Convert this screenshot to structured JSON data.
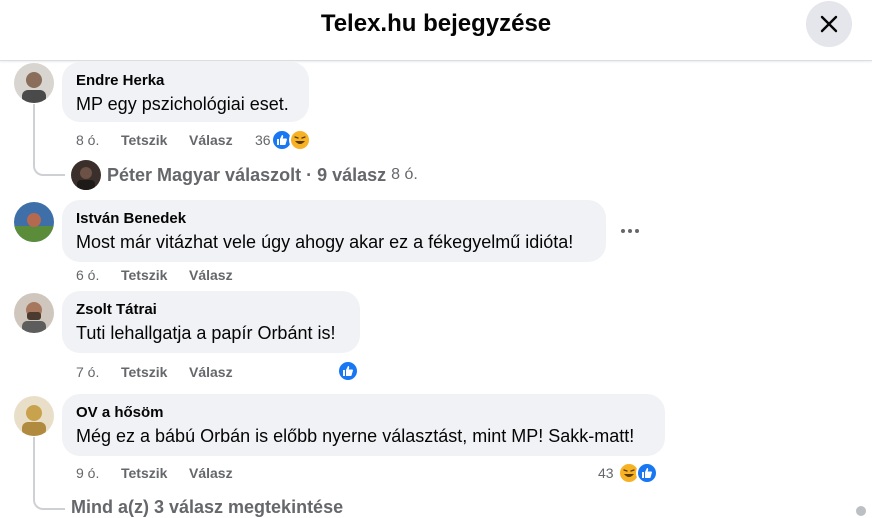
{
  "header": {
    "title": "Telex.hu bejegyzése"
  },
  "comments": [
    {
      "author": "Endre Herka",
      "text": "MP egy pszichológiai eset.",
      "time": "8 ó.",
      "like_label": "Tetszik",
      "reply_label": "Válasz",
      "reaction_count": "36",
      "reactions": [
        "like-icon",
        "haha-icon"
      ]
    },
    {
      "author": "István Benedek",
      "text": "Most már vitázhat vele úgy ahogy akar ez a fékegyelmű idióta!",
      "time": "6 ó.",
      "like_label": "Tetszik",
      "reply_label": "Válasz"
    },
    {
      "author": "Zsolt Tátrai",
      "text": "Tuti lehallgatja a papír Orbánt is!",
      "time": "7 ó.",
      "like_label": "Tetszik",
      "reply_label": "Válasz",
      "reactions": [
        "like-icon"
      ]
    },
    {
      "author": "OV a hősöm",
      "text": "Még ez a bábú Orbán is előbb nyerne választást, mint MP! Sakk-matt!",
      "time": "9 ó.",
      "like_label": "Tetszik",
      "reply_label": "Válasz",
      "reaction_count": "43",
      "reactions": [
        "haha-icon",
        "like-icon"
      ]
    }
  ],
  "reply_summary": {
    "text": "Péter Magyar válaszolt",
    "separator": "·",
    "count": "9 válasz",
    "time": "8 ó."
  },
  "view_more": {
    "text": "Mind a(z) 3 válasz megtekintése"
  },
  "colors": {
    "link_blue": "#1877f2",
    "bubble": "#f0f2f5",
    "muted": "#65676b",
    "haha": "#f7b125"
  }
}
